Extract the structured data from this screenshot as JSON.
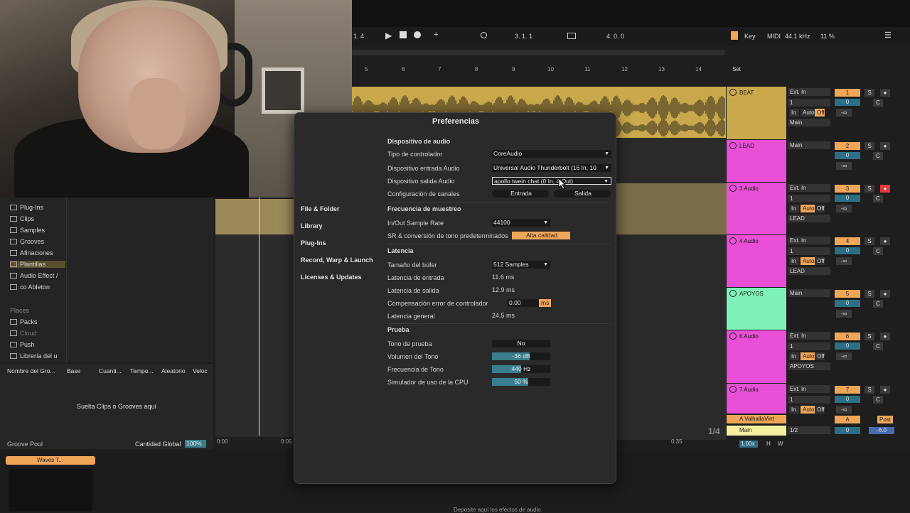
{
  "transport": {
    "arrangement_pos": "1.   4",
    "song_pos": "3.   1.   1",
    "loop_length": "4.   0.   0",
    "key_label": "Key",
    "midi_label": "MIDI",
    "sample_rate": "44.1 kHz",
    "cpu": "11 %"
  },
  "ruler": {
    "ticks": [
      "5",
      "6",
      "7",
      "8",
      "9",
      "10",
      "11",
      "12",
      "13",
      "14"
    ],
    "set_label": "Set"
  },
  "tracks": [
    {
      "name": "BEAT",
      "color": "#c9a94b",
      "io1": "Ext. In",
      "io2": "1",
      "monitor": [
        "In",
        "Auto",
        "Off"
      ],
      "out": "Main",
      "num": "1",
      "vol": "0",
      "pan": "C",
      "send": "-∞"
    },
    {
      "name": "LEAD",
      "color": "#e84fd6",
      "io1": "Main",
      "num": "2",
      "vol": "0",
      "pan": "C",
      "send": "-∞"
    },
    {
      "name": "3 Audio",
      "color": "#e84fd6",
      "io1": "Ext. In",
      "io2": "1",
      "monitor": [
        "In",
        "Auto",
        "Off"
      ],
      "out": "LEAD",
      "num": "3",
      "vol": "0",
      "pan": "C",
      "send": "-∞"
    },
    {
      "name": "4 Audio",
      "color": "#e84fd6",
      "io1": "Ext. In",
      "io2": "1",
      "monitor": [
        "In",
        "Auto",
        "Off"
      ],
      "out": "LEAD",
      "num": "4",
      "vol": "0",
      "pan": "C",
      "send": "-∞"
    },
    {
      "name": "APOYOS",
      "color": "#7ef2b7",
      "io1": "Main",
      "num": "5",
      "vol": "0",
      "pan": "C",
      "send": "-∞"
    },
    {
      "name": "6 Audio",
      "color": "#e84fd6",
      "io1": "Ext. In",
      "io2": "1",
      "monitor": [
        "In",
        "Auto",
        "Off"
      ],
      "out": "APOYOS",
      "num": "6",
      "vol": "0",
      "pan": "C",
      "send": "-∞"
    },
    {
      "name": "7 Audio",
      "color": "#e84fd6",
      "io1": "Ext. In",
      "io2": "1",
      "monitor": [
        "In",
        "Auto",
        "Off"
      ],
      "num": "7",
      "vol": "0",
      "pan": "C",
      "send": "-∞"
    }
  ],
  "return_track": {
    "name": "A ValhallaVint",
    "num": "A",
    "vol": "0",
    "post": "Post"
  },
  "main_track": {
    "name": "Main",
    "io": "1/2",
    "vol": "0",
    "db": "-6.0",
    "fraction": "1/4",
    "zoom": "1.00x",
    "h": "H",
    "w": "W"
  },
  "browser": {
    "items": [
      "Plug-Ins",
      "Clips",
      "Samples",
      "Grooves",
      "Afinaciones",
      "Plantillas",
      "Audio Effect /",
      "co Ableton"
    ],
    "places_label": "Places",
    "places": [
      "Packs",
      "Cloud",
      "Push",
      "Librería del u"
    ]
  },
  "groove_pool": {
    "headers": [
      "Nombre del Gro...",
      "Base",
      "Cuanti...",
      "Tempo...",
      "Aleatorio",
      "Veloc"
    ],
    "empty_text": "Suelta Clips o Grooves aquí",
    "footer_label": "Groove Pool",
    "global_amount_label": "Cantidad Global",
    "global_amount": "100%"
  },
  "timecodes": [
    "0:00",
    "0:05",
    "0:35"
  ],
  "bottom": {
    "device_name": "Waves T...",
    "drop_text": "Deposite aquí los efectos de audio"
  },
  "prefs": {
    "title": "Preferencias",
    "nav": [
      "File & Folder",
      "Library",
      "Plug-Ins",
      "Record, Warp & Launch",
      "Licenses & Updates"
    ],
    "sections": {
      "audio_device": "Dispositivo de audio",
      "sample_rate": "Frecuencia de muestreo",
      "latency": "Latencia",
      "test": "Prueba"
    },
    "driver_type_label": "Tipo de controlador",
    "driver_type": "CoreAudio",
    "input_device_label": "Dispositivo entrada Audio",
    "input_device": "Universal Audio Thunderbolt (16 In, 10",
    "output_device_label": "Dispositivo salida Audio",
    "output_device": "apollo twein chat (0 In, 4 Out)",
    "channel_config_label": "Configuración de canales",
    "input_btn": "Entrada",
    "output_btn": "Salida",
    "io_sample_rate_label": "In/Out Sample Rate",
    "io_sample_rate": "44100",
    "sr_conversion_label": "SR & conversión de tono predeterminados",
    "sr_conversion": "Alta calidad",
    "buffer_label": "Tamaño del búfer",
    "buffer": "512 Samples",
    "input_latency_label": "Latencia de entrada",
    "input_latency": "11.6 ms",
    "output_latency_label": "Latencia de salida",
    "output_latency": "12.9 ms",
    "driver_comp_label": "Compensación error de controlador",
    "driver_comp": "0.00",
    "driver_comp_unit": "ms",
    "overall_latency_label": "Latencia general",
    "overall_latency": "24.5 ms",
    "test_tone_label": "Tono de prueba",
    "test_tone": "No",
    "tone_volume_label": "Volumen del Tono",
    "tone_volume": "-36 dB",
    "tone_volume_level": 0.65,
    "tone_freq_label": "Frecuencia de Tono",
    "tone_freq": "440 Hz",
    "tone_freq_level": 0.5,
    "cpu_sim_label": "Simulador de uso de la CPU",
    "cpu_sim": "50 %",
    "cpu_sim_level": 0.62
  }
}
